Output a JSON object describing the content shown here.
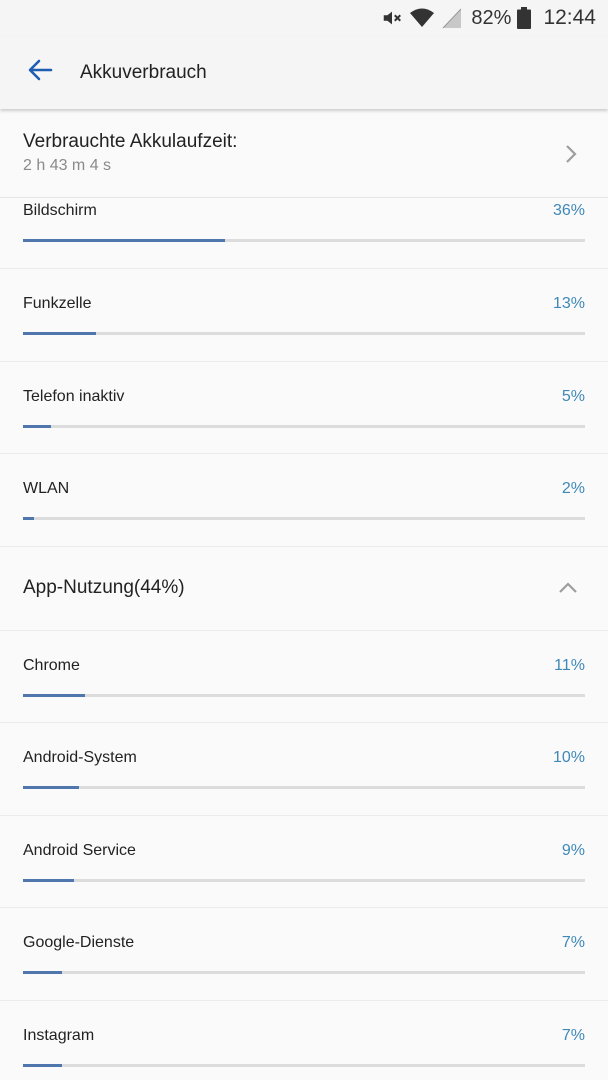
{
  "status_bar": {
    "icons": [
      "mute-icon",
      "wifi-icon",
      "signal-icon",
      "battery-icon"
    ],
    "battery_pct": "82%",
    "time": "12:44"
  },
  "app_bar": {
    "back_icon": "arrow-left-icon",
    "title": "Akkuverbrauch"
  },
  "summary": {
    "title": "Verbrauchte Akkulaufzeit:",
    "value": "2 h 43 m 4 s",
    "icon": "chevron-right-icon"
  },
  "hardware_usage": [
    {
      "label": "Bildschirm",
      "pct_text": "36%",
      "fraction": 0.36
    },
    {
      "label": "Funkzelle",
      "pct_text": "13%",
      "fraction": 0.13
    },
    {
      "label": "Telefon inaktiv",
      "pct_text": "5%",
      "fraction": 0.05
    },
    {
      "label": "WLAN",
      "pct_text": "2%",
      "fraction": 0.02
    }
  ],
  "app_section": {
    "title": "App-Nutzung(44%)",
    "icon": "chevron-up-icon",
    "expanded": true
  },
  "app_usage": [
    {
      "label": "Chrome",
      "pct_text": "11%",
      "fraction": 0.11
    },
    {
      "label": "Android-System",
      "pct_text": "10%",
      "fraction": 0.1
    },
    {
      "label": "Android Service",
      "pct_text": "9%",
      "fraction": 0.09
    },
    {
      "label": "Google-Dienste",
      "pct_text": "7%",
      "fraction": 0.07
    },
    {
      "label": "Instagram",
      "pct_text": "7%",
      "fraction": 0.07
    }
  ],
  "colors": {
    "accent_blue": "#1e5db0",
    "bar_fill": "#4f76ad",
    "bar_track": "#dcdcdc",
    "percent_text": "#3f88b7"
  }
}
